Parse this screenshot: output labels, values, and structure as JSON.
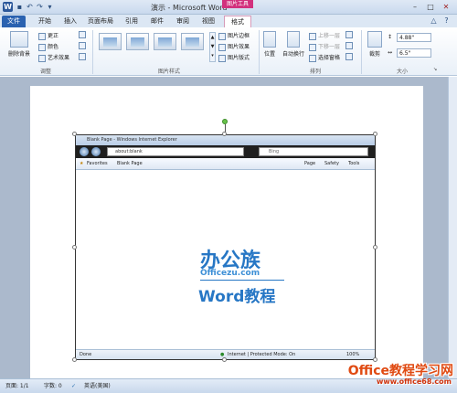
{
  "window": {
    "title": "演示 - Microsoft Word",
    "contextual_tab_group": "图片工具"
  },
  "tabs": [
    "文件",
    "开始",
    "插入",
    "页面布局",
    "引用",
    "邮件",
    "审阅",
    "视图",
    "格式"
  ],
  "ribbon": {
    "adjust": {
      "remove_background": "删除背景",
      "corrections": "更正",
      "color": "颜色",
      "artistic_effects": "艺术效果",
      "label": "调整"
    },
    "picture_styles": {
      "border": "图片边框",
      "effects": "图片效果",
      "layout": "图片版式",
      "label": "图片样式"
    },
    "arrange": {
      "position": "位置",
      "wrap_text": "自动换行",
      "bring_forward": "上移一层",
      "send_backward": "下移一层",
      "selection_pane": "选择窗格",
      "label": "排列"
    },
    "size": {
      "crop": "裁剪",
      "height": "4.88\"",
      "width": "6.5\"",
      "label": "大小"
    }
  },
  "ie": {
    "title": "Blank Page - Windows Internet Explorer",
    "address": "about:blank",
    "search": "Bing",
    "favorites": "Favorites",
    "tab": "Blank Page",
    "page_menu": "Page",
    "safety_menu": "Safety",
    "tools_menu": "Tools",
    "status_left": "Done",
    "status_zone": "Internet | Protected Mode: On",
    "zoom": "100%"
  },
  "logo": {
    "main": "办公族",
    "sub": "Officezu.com",
    "word": "Word教程"
  },
  "statusbar": {
    "page": "页面: 1/1",
    "words": "字数: 0",
    "language": "英语(美国)"
  },
  "watermark": {
    "main": "Office教程学习网",
    "url": "www.office68.com"
  }
}
